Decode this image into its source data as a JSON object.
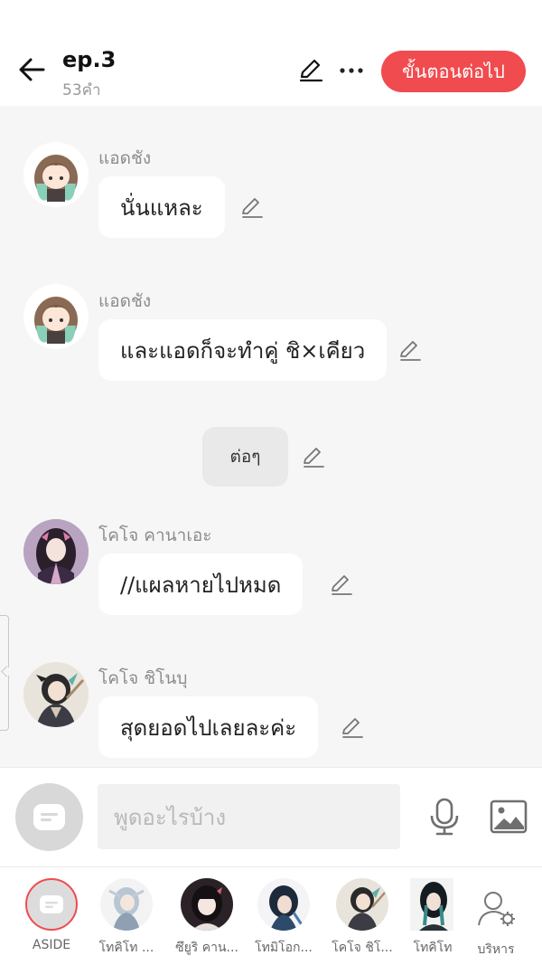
{
  "header": {
    "title": "ep.3",
    "subtitle": "53คำ",
    "next_label": "ขั้นตอนต่อไป"
  },
  "messages": [
    {
      "sender": "แอดชัง",
      "text": "นั่นแหละ"
    },
    {
      "sender": "แอดชัง",
      "text": "และแอดก็จะทำคู่ ชิ×เคียว"
    },
    {
      "text": "ต่อๆ"
    },
    {
      "sender": "โคโจ คานาเอะ",
      "text": "//แผลหายไปหมด"
    },
    {
      "sender": "โคโจ ชิโนบุ",
      "text": "สุดยอดไปเลยละค่ะ"
    }
  ],
  "input": {
    "placeholder": "พูดอะไรบ้าง"
  },
  "bottom_bar": {
    "items": [
      {
        "label": "ASIDE"
      },
      {
        "label": "โทคิโท ..."
      },
      {
        "label": "ซึยูริ คาน..."
      },
      {
        "label": "โทมิโอก..."
      },
      {
        "label": "โคโจ ชิโ..."
      },
      {
        "label": "โทคิโท"
      },
      {
        "label": "บริหาร"
      }
    ]
  },
  "colors": {
    "accent": "#f04b4f",
    "background": "#f6f6f6",
    "bubble": "#ffffff"
  }
}
